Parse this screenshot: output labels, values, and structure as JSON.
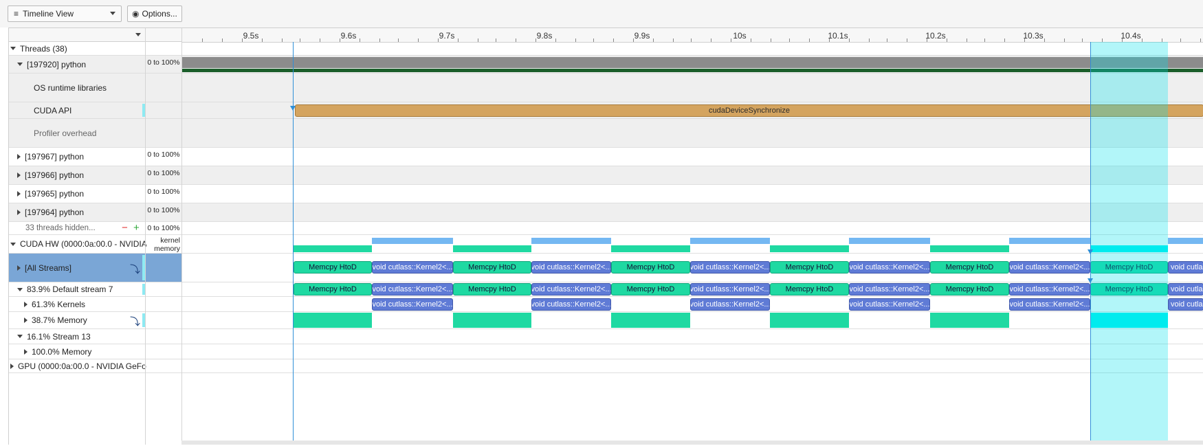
{
  "toolbar": {
    "view_label": "Timeline View",
    "options_label": "Options..."
  },
  "ruler": {
    "ticks": [
      "9.5s",
      "9.6s",
      "9.7s",
      "9.8s",
      "9.9s",
      "10s",
      "10.1s",
      "10.2s",
      "10.3s",
      "10.4s"
    ]
  },
  "rows": {
    "threads": "Threads (38)",
    "python_main": "[197920] python",
    "os_runtime": "OS runtime libraries",
    "cuda_api": "CUDA API",
    "profiler_overhead": "Profiler overhead",
    "python_197967": "[197967] python",
    "python_197966": "[197966] python",
    "python_197965": "[197965] python",
    "python_197964": "[197964] python",
    "hidden_threads": "33 threads hidden...",
    "cuda_hw": "CUDA HW (0000:0a:00.0 - NVIDIA",
    "all_streams": "[All Streams]",
    "default_stream": "83.9% Default stream 7",
    "kernels": "61.3% Kernels",
    "memory": "38.7% Memory",
    "stream13": "16.1% Stream 13",
    "stream13_memory": "100.0% Memory",
    "gpu": "GPU (0000:0a:00.0 - NVIDIA GeFor"
  },
  "scales": {
    "percent": "0 to 100%",
    "kernel_memory_1": "kernel",
    "kernel_memory_2": "memory"
  },
  "events": {
    "cuda_sync": "cudaDeviceSynchronize",
    "memcpy": "Memcpy HtoD",
    "kernel": "void cutlass::Kernel2<...",
    "kernel_short": "void cutlass"
  },
  "colors": {
    "memcpy": "#1fd9a2",
    "kernel": "#5f7bd6",
    "cuda_api": "#d4a45f",
    "selection": "#a3eef2",
    "cursor": "#2f8fd8",
    "thread_bar": "#8c8c8c",
    "thread_line": "#1b5e2a"
  },
  "icons": {
    "menu": "hamburger-icon",
    "options": "eye-icon",
    "add": "plus-icon",
    "remove": "minus-icon",
    "pin": "pin-arrow-icon"
  }
}
